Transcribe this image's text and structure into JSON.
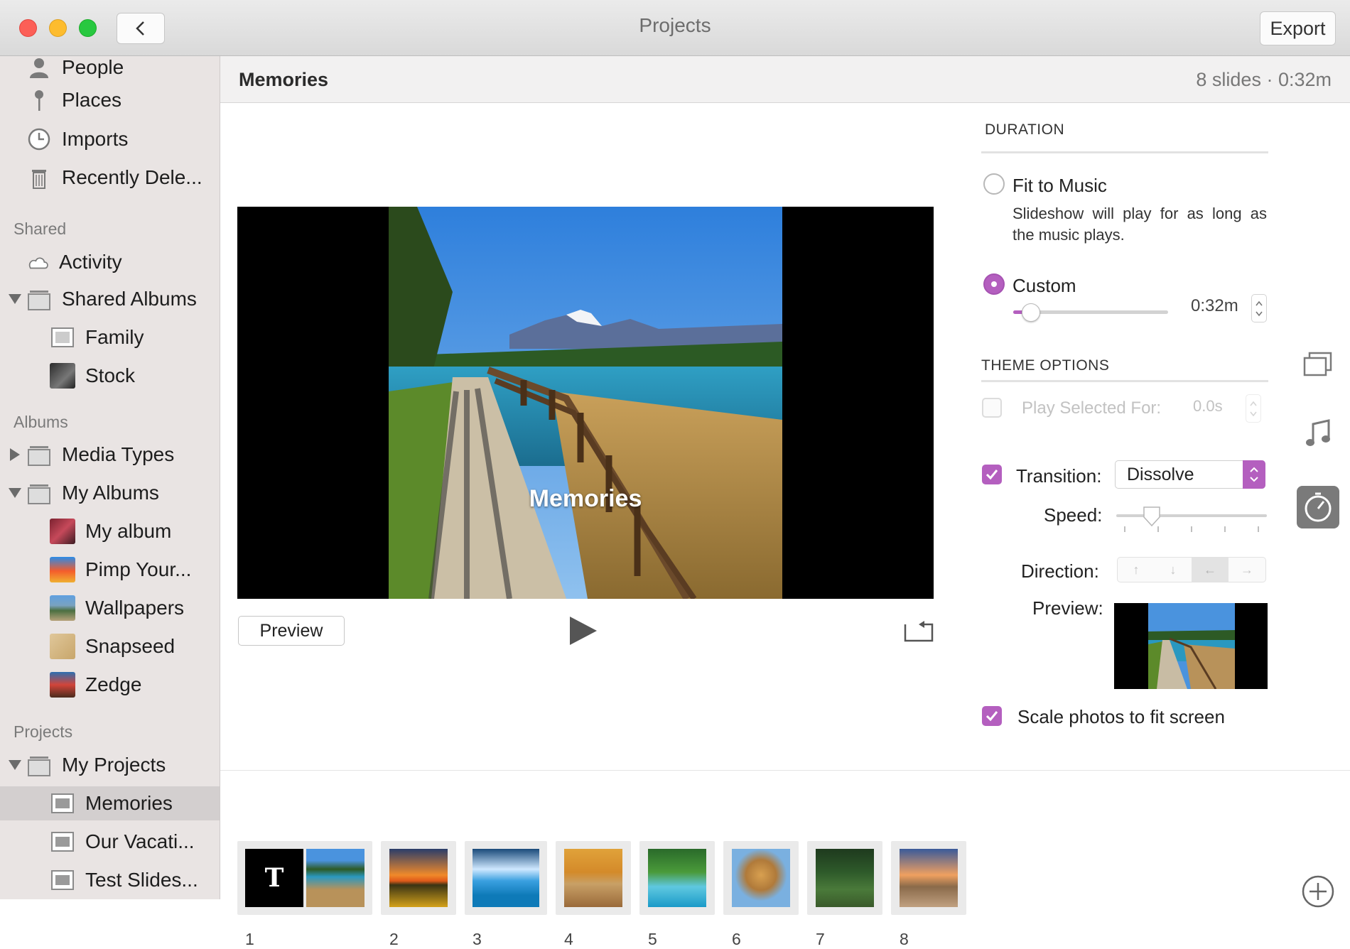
{
  "window": {
    "title": "Projects",
    "export_label": "Export"
  },
  "sidebar": {
    "top_items": [
      {
        "label": "People",
        "icon": "person-icon"
      },
      {
        "label": "Places",
        "icon": "pin-icon"
      },
      {
        "label": "Imports",
        "icon": "clock-icon"
      },
      {
        "label": "Recently Dele...",
        "icon": "trash-icon"
      }
    ],
    "shared_header": "Shared",
    "shared_items": [
      {
        "label": "Activity",
        "icon": "cloud-icon"
      },
      {
        "label": "Shared Albums",
        "icon": "album-stack-icon"
      },
      {
        "label": "Family",
        "icon": "album-icon"
      },
      {
        "label": "Stock",
        "icon": "album-thumb"
      }
    ],
    "albums_header": "Albums",
    "albums_items": [
      {
        "label": "Media Types"
      },
      {
        "label": "My Albums"
      },
      {
        "label": "My album"
      },
      {
        "label": "Pimp Your..."
      },
      {
        "label": "Wallpapers"
      },
      {
        "label": "Snapseed"
      },
      {
        "label": "Zedge"
      }
    ],
    "projects_header": "Projects",
    "projects_items": [
      {
        "label": "My Projects"
      },
      {
        "label": "Memories"
      },
      {
        "label": "Our Vacati..."
      },
      {
        "label": "Test Slides..."
      }
    ]
  },
  "main": {
    "project_title": "Memories",
    "project_meta": "8 slides · 0:32m",
    "slide_caption": "Memories",
    "preview_label": "Preview"
  },
  "duration": {
    "section_title": "DURATION",
    "fit_to_music_label": "Fit to Music",
    "fit_to_music_desc": "Slideshow will play for as long as the music plays.",
    "custom_label": "Custom",
    "custom_value": "0:32m",
    "custom_slider_fraction": 0.1
  },
  "theme_options": {
    "section_title": "THEME OPTIONS",
    "play_selected_label": "Play Selected For:",
    "play_selected_value": "0.0s",
    "transition_label": "Transition:",
    "transition_value": "Dissolve",
    "speed_label": "Speed:",
    "speed_fraction": 0.23,
    "direction_label": "Direction:",
    "direction_selected": "left",
    "preview_label": "Preview:",
    "scale_label": "Scale photos to fit screen"
  },
  "filmstrip": {
    "slides": [
      {
        "num": "1",
        "title_glyph": "T"
      },
      {
        "num": "2"
      },
      {
        "num": "3"
      },
      {
        "num": "4"
      },
      {
        "num": "5"
      },
      {
        "num": "6"
      },
      {
        "num": "7"
      },
      {
        "num": "8"
      }
    ]
  },
  "colors": {
    "accent": "#b45fbf",
    "sidebar_bg": "#e9e4e3"
  }
}
